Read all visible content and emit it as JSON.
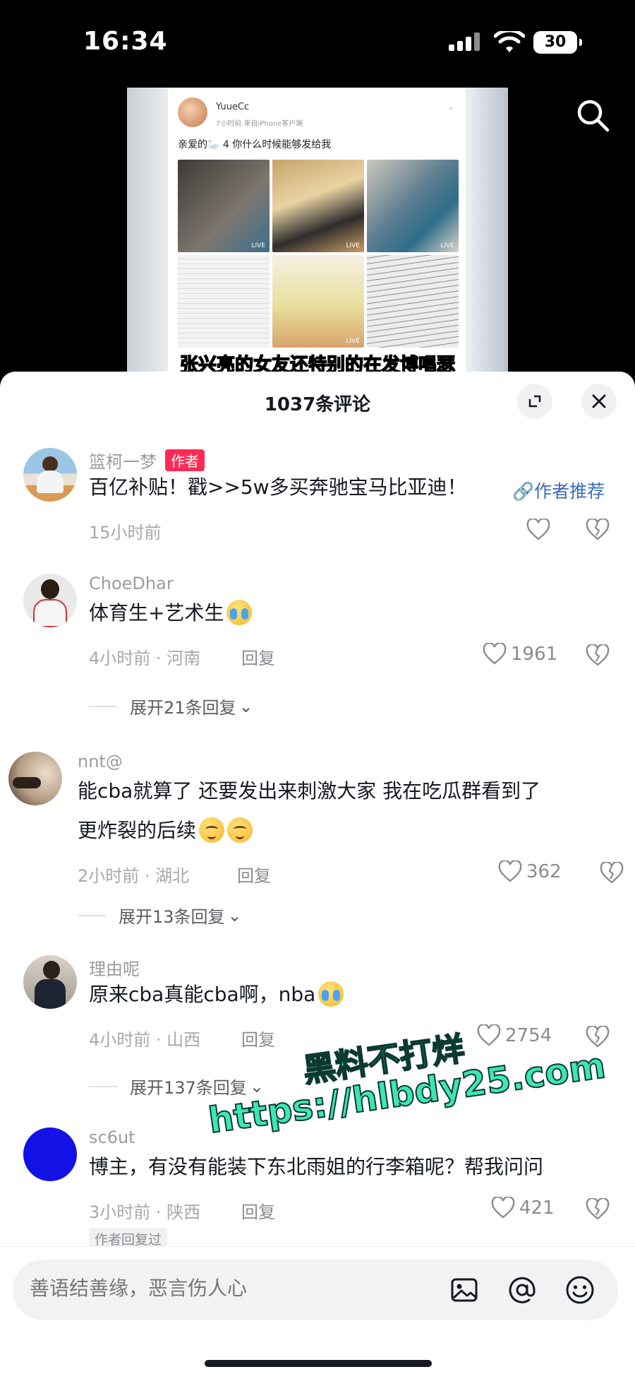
{
  "status_bar": {
    "time": "16:34",
    "battery": "30"
  },
  "video": {
    "post_username": "YuueCc",
    "post_meta": "7小时前  来自iPhone客户端",
    "post_text": "亲爱的🦢 4  你什么时候能够发给我",
    "live_badge": "LIVE",
    "subtitle": "张兴亮的女友还特别的在发博唱瑟"
  },
  "sheet": {
    "title": "1037条评论"
  },
  "comments": [
    {
      "username": "篮柯一梦",
      "author_tag": "作者",
      "text": "百亿补贴！戳>>5w多买奔驰宝马比亚迪！",
      "author_recommend": "作者推荐",
      "time": "15小时前"
    },
    {
      "username": "ChoeDhar",
      "text": "体育生+艺术生",
      "meta": "4小时前 · 河南",
      "reply": "回复",
      "likes": "1961",
      "expand": "展开21条回复"
    },
    {
      "username": "nnt@",
      "text_line1": "能cba就算了 还要发出来刺激大家 我在吃瓜群看到了",
      "text_line2": "更炸裂的后续",
      "meta": "2小时前 · 湖北",
      "reply": "回复",
      "likes": "362",
      "expand": "展开13条回复"
    },
    {
      "username": "理由呢",
      "text": "原来cba真能cba啊，nba",
      "meta": "4小时前 · 山西",
      "reply": "回复",
      "likes": "2754",
      "expand": "展开137条回复"
    },
    {
      "username": "sc6ut",
      "text": "博主，有没有能装下东北雨姐的行李箱呢？帮我问问",
      "meta": "3小时前 · 陕西",
      "reply": "回复",
      "likes": "421",
      "author_replied": "作者回复过"
    }
  ],
  "watermark": {
    "line1": "黑料不打烊",
    "line2": "https://hlbdy25.com"
  },
  "input": {
    "placeholder": "善语结善缘，恶言伤人心"
  },
  "colors": {
    "accent_red": "#fe2c55",
    "link_blue": "#3a6bbf",
    "watermark_green": "#3ee6b4"
  }
}
